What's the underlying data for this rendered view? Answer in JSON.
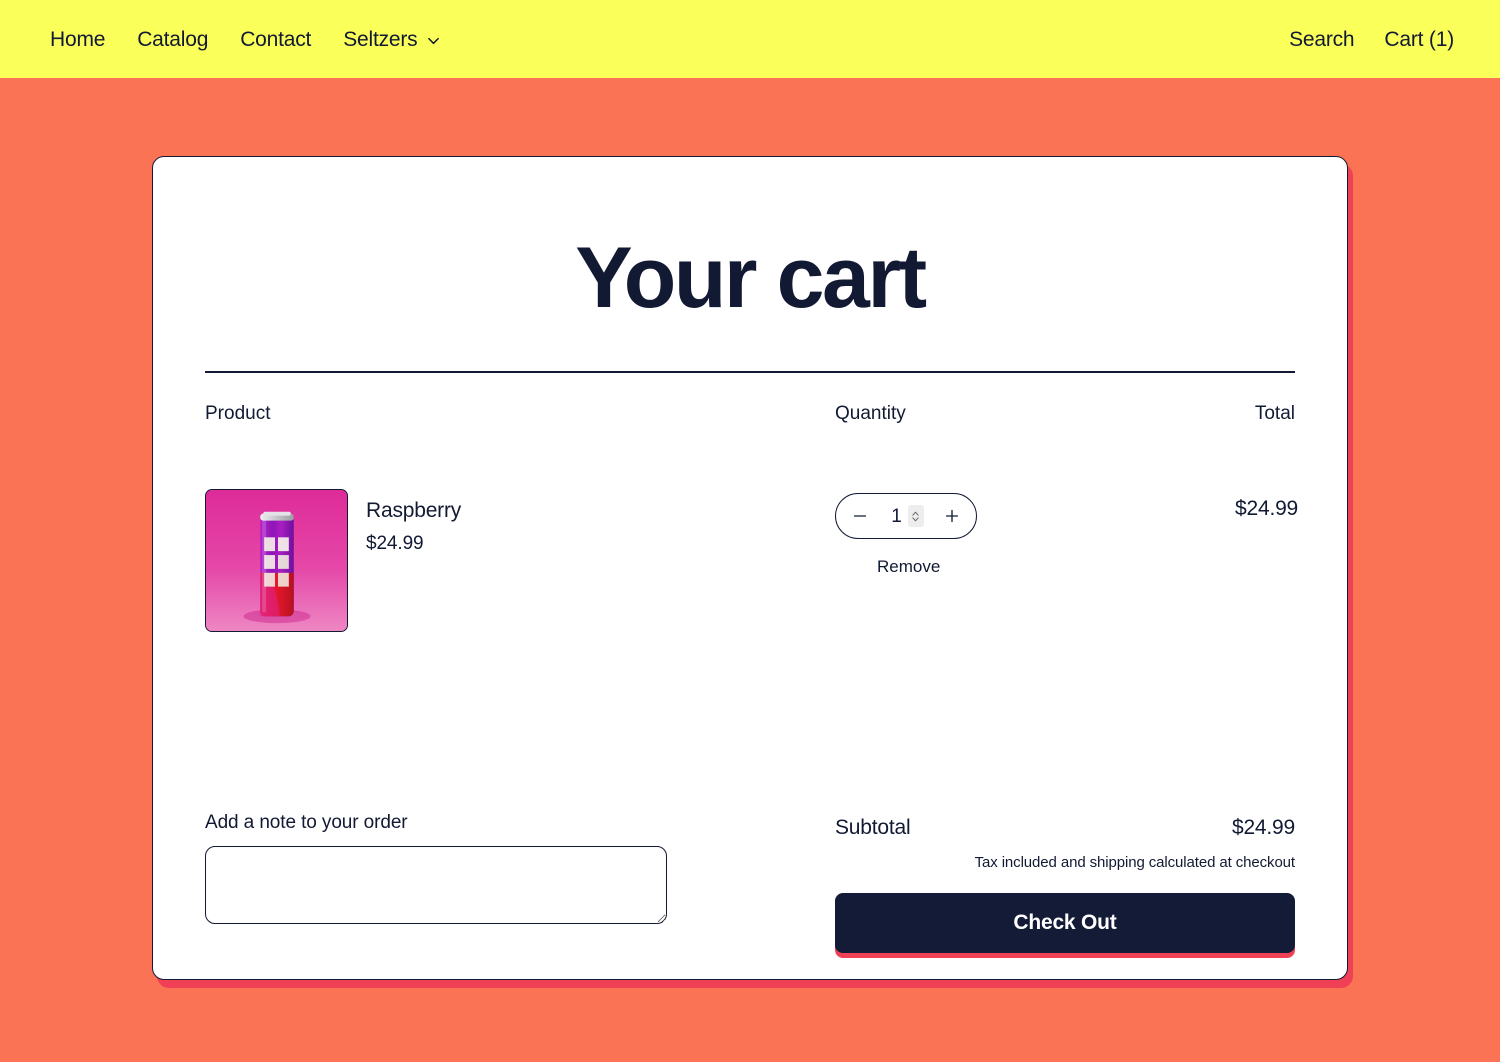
{
  "header": {
    "nav_links": [
      {
        "label": "Home",
        "name": "nav-link-home"
      },
      {
        "label": "Catalog",
        "name": "nav-link-catalog"
      },
      {
        "label": "Contact",
        "name": "nav-link-contact"
      }
    ],
    "dropdown": {
      "label": "Seltzers",
      "icon": "chevron-down-icon"
    },
    "search_label": "Search",
    "cart_label": "Cart (1)",
    "background_color": "#FAFF5A"
  },
  "page": {
    "title": "Your cart",
    "background_color": "#FB7355",
    "card_background": "#FFFFFF",
    "accent_color": "#EF4056",
    "text_color": "#121A33"
  },
  "table": {
    "headers": {
      "product": "Product",
      "quantity": "Quantity",
      "total": "Total"
    },
    "items": [
      {
        "name": "Raspberry",
        "price": "$24.99",
        "quantity": "1",
        "line_total": "$24.99",
        "remove_label": "Remove",
        "thumbnail": {
          "alt": "raspberry-seltzer-can",
          "background_color": "#E0399B",
          "can_top_color": "#C9C9CE",
          "can_upper_color": "#A41FC4",
          "can_lower_color": "#E8172B"
        }
      }
    ]
  },
  "footer": {
    "note_label": "Add a note to your order",
    "note_value": "",
    "note_placeholder": "",
    "subtotal_label": "Subtotal",
    "subtotal_value": "$24.99",
    "tax_note": "Tax included and shipping calculated at checkout",
    "checkout_label": "Check Out"
  },
  "icons": {
    "minus": "minus-icon",
    "plus": "plus-icon",
    "spinner": "number-spinner-icon"
  }
}
